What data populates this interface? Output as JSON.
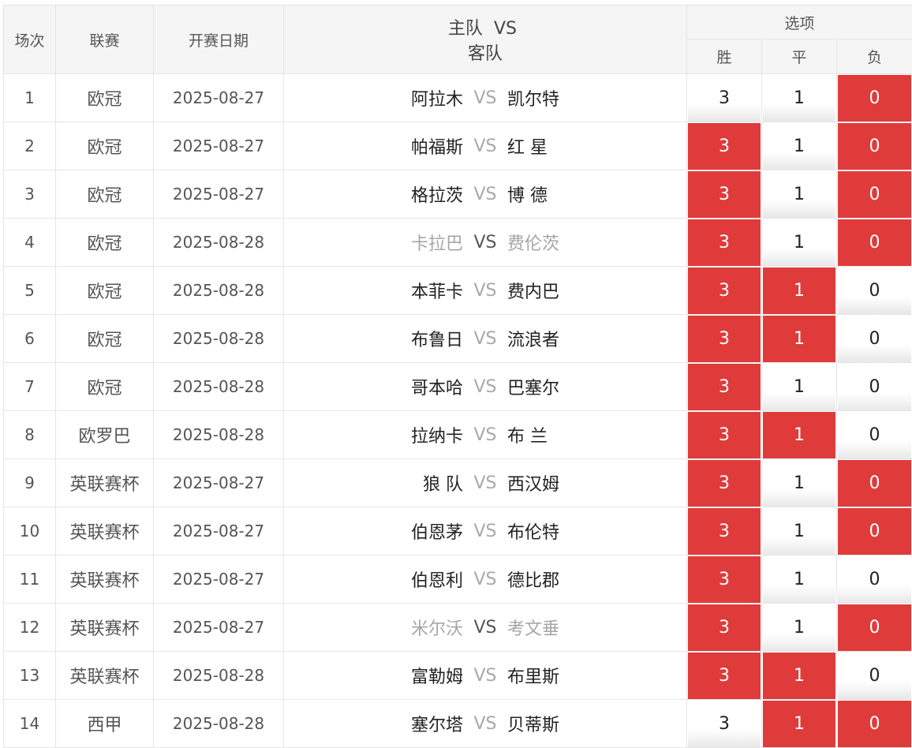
{
  "headers": {
    "round": "场次",
    "league": "联赛",
    "date": "开赛日期",
    "home": "主队",
    "vs": "VS",
    "away": "客队",
    "options": "选项",
    "win": "胜",
    "draw": "平",
    "lose": "负"
  },
  "colors": {
    "selected": "#e03b3b",
    "header_bg": "#f5f5f5",
    "muted_team": "#a6a6a6"
  },
  "rows": [
    {
      "no": "1",
      "league": "欧冠",
      "date": "2025-08-27",
      "home": "阿拉木",
      "vs": "VS",
      "away": "凯尔特",
      "dim": false,
      "win": "3",
      "draw": "1",
      "lose": "0",
      "sel_win": false,
      "sel_draw": false,
      "sel_lose": true
    },
    {
      "no": "2",
      "league": "欧冠",
      "date": "2025-08-27",
      "home": "帕福斯",
      "vs": "VS",
      "away": "红 星",
      "dim": false,
      "win": "3",
      "draw": "1",
      "lose": "0",
      "sel_win": true,
      "sel_draw": false,
      "sel_lose": true
    },
    {
      "no": "3",
      "league": "欧冠",
      "date": "2025-08-27",
      "home": "格拉茨",
      "vs": "VS",
      "away": "博 德",
      "dim": false,
      "win": "3",
      "draw": "1",
      "lose": "0",
      "sel_win": true,
      "sel_draw": false,
      "sel_lose": true
    },
    {
      "no": "4",
      "league": "欧冠",
      "date": "2025-08-28",
      "home": "卡拉巴",
      "vs": "VS",
      "away": "费伦茨",
      "dim": true,
      "win": "3",
      "draw": "1",
      "lose": "0",
      "sel_win": true,
      "sel_draw": false,
      "sel_lose": true
    },
    {
      "no": "5",
      "league": "欧冠",
      "date": "2025-08-28",
      "home": "本菲卡",
      "vs": "VS",
      "away": "费内巴",
      "dim": false,
      "win": "3",
      "draw": "1",
      "lose": "0",
      "sel_win": true,
      "sel_draw": true,
      "sel_lose": false
    },
    {
      "no": "6",
      "league": "欧冠",
      "date": "2025-08-28",
      "home": "布鲁日",
      "vs": "VS",
      "away": "流浪者",
      "dim": false,
      "win": "3",
      "draw": "1",
      "lose": "0",
      "sel_win": true,
      "sel_draw": true,
      "sel_lose": false
    },
    {
      "no": "7",
      "league": "欧冠",
      "date": "2025-08-28",
      "home": "哥本哈",
      "vs": "VS",
      "away": "巴塞尔",
      "dim": false,
      "win": "3",
      "draw": "1",
      "lose": "0",
      "sel_win": true,
      "sel_draw": false,
      "sel_lose": false
    },
    {
      "no": "8",
      "league": "欧罗巴",
      "date": "2025-08-28",
      "home": "拉纳卡",
      "vs": "VS",
      "away": "布 兰",
      "dim": false,
      "win": "3",
      "draw": "1",
      "lose": "0",
      "sel_win": true,
      "sel_draw": true,
      "sel_lose": false
    },
    {
      "no": "9",
      "league": "英联赛杯",
      "date": "2025-08-27",
      "home": "狼 队",
      "vs": "VS",
      "away": "西汉姆",
      "dim": false,
      "win": "3",
      "draw": "1",
      "lose": "0",
      "sel_win": true,
      "sel_draw": false,
      "sel_lose": true
    },
    {
      "no": "10",
      "league": "英联赛杯",
      "date": "2025-08-27",
      "home": "伯恩茅",
      "vs": "VS",
      "away": "布伦特",
      "dim": false,
      "win": "3",
      "draw": "1",
      "lose": "0",
      "sel_win": true,
      "sel_draw": false,
      "sel_lose": true
    },
    {
      "no": "11",
      "league": "英联赛杯",
      "date": "2025-08-27",
      "home": "伯恩利",
      "vs": "VS",
      "away": "德比郡",
      "dim": false,
      "win": "3",
      "draw": "1",
      "lose": "0",
      "sel_win": true,
      "sel_draw": false,
      "sel_lose": false
    },
    {
      "no": "12",
      "league": "英联赛杯",
      "date": "2025-08-27",
      "home": "米尔沃",
      "vs": "VS",
      "away": "考文垂",
      "dim": true,
      "win": "3",
      "draw": "1",
      "lose": "0",
      "sel_win": true,
      "sel_draw": false,
      "sel_lose": true
    },
    {
      "no": "13",
      "league": "英联赛杯",
      "date": "2025-08-28",
      "home": "富勒姆",
      "vs": "VS",
      "away": "布里斯",
      "dim": false,
      "win": "3",
      "draw": "1",
      "lose": "0",
      "sel_win": true,
      "sel_draw": true,
      "sel_lose": false
    },
    {
      "no": "14",
      "league": "西甲",
      "date": "2025-08-28",
      "home": "塞尔塔",
      "vs": "VS",
      "away": "贝蒂斯",
      "dim": false,
      "win": "3",
      "draw": "1",
      "lose": "0",
      "sel_win": false,
      "sel_draw": true,
      "sel_lose": true
    }
  ]
}
